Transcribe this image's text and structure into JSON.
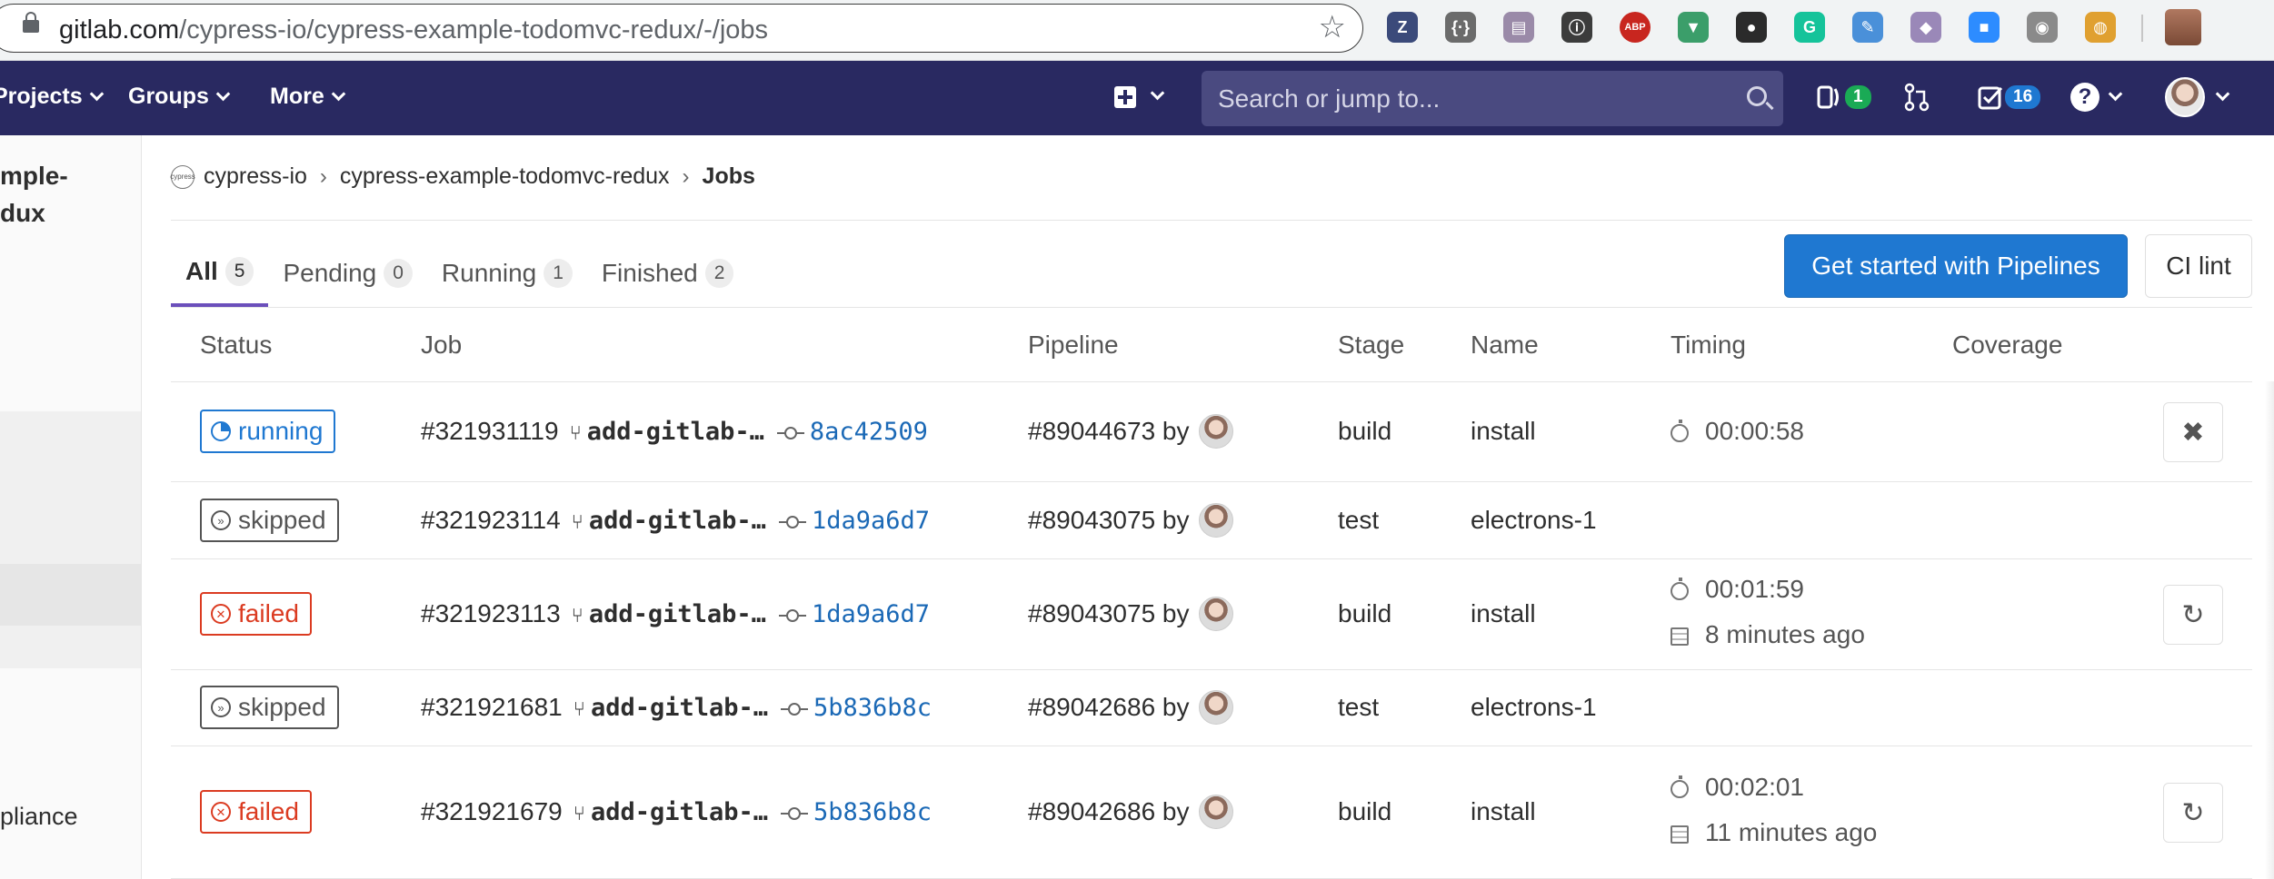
{
  "browser": {
    "url_host": "gitlab.com",
    "url_path": "/cypress-io/cypress-example-todomvc-redux/-/jobs",
    "extensions": [
      {
        "icon": "zotero-icon",
        "glyph": "Z",
        "color": "#3b4a7a"
      },
      {
        "icon": "code-braces-icon",
        "glyph": "{·}",
        "color": "#6b6b6b"
      },
      {
        "icon": "document-extension-icon",
        "glyph": "▤",
        "color": "#9a8aa8"
      },
      {
        "icon": "1password-icon",
        "glyph": "ⓘ",
        "color": "#3c3c3c"
      },
      {
        "icon": "adblock-plus-icon",
        "glyph": "ABP",
        "color": "#c8261f"
      },
      {
        "icon": "vue-devtools-icon",
        "glyph": "▼",
        "color": "#3b9e6a"
      },
      {
        "icon": "bug-mascot-icon",
        "glyph": "●",
        "color": "#2b2b2b"
      },
      {
        "icon": "grammarly-icon",
        "glyph": "G",
        "color": "#15c39a"
      },
      {
        "icon": "feather-icon",
        "glyph": "✎",
        "color": "#4a90d9"
      },
      {
        "icon": "octocat-icon",
        "glyph": "◆",
        "color": "#9a88b8"
      },
      {
        "icon": "zoom-camera-icon",
        "glyph": "■",
        "color": "#2d8cff"
      },
      {
        "icon": "screenshot-camera-icon",
        "glyph": "◉",
        "color": "#8a8a8a"
      },
      {
        "icon": "globe-icon",
        "glyph": "◍",
        "color": "#e0a030"
      }
    ]
  },
  "header": {
    "nav": [
      "Projects",
      "Groups",
      "More"
    ],
    "search_placeholder": "Search or jump to...",
    "issues_count": "1",
    "todos_count": "16",
    "help_glyph": "?"
  },
  "sidebar": {
    "title_line1": "mple-",
    "title_line2": "dux",
    "bottom_item": "pliance"
  },
  "breadcrumb": {
    "group_logo_text": "cypress",
    "group": "cypress-io",
    "project": "cypress-example-todomvc-redux",
    "current": "Jobs",
    "separator": "›"
  },
  "tabs": [
    {
      "label": "All",
      "count": "5"
    },
    {
      "label": "Pending",
      "count": "0"
    },
    {
      "label": "Running",
      "count": "1"
    },
    {
      "label": "Finished",
      "count": "2"
    }
  ],
  "actions": {
    "pipelines_button": "Get started with Pipelines",
    "ci_lint_button": "CI lint"
  },
  "table": {
    "columns": [
      "Status",
      "Job",
      "Pipeline",
      "Stage",
      "Name",
      "Timing",
      "Coverage"
    ],
    "rows": [
      {
        "status": "running",
        "job": "#321931119",
        "branch": "add-gitlab-…",
        "sha": "8ac42509",
        "pipeline": "#89044673 by",
        "stage": "build",
        "name": "install",
        "duration": "00:00:58",
        "finished": "",
        "action": "cancel-icon",
        "action_glyph": "✖"
      },
      {
        "status": "skipped",
        "job": "#321923114",
        "branch": "add-gitlab-…",
        "sha": "1da9a6d7",
        "pipeline": "#89043075 by",
        "stage": "test",
        "name": "electrons-1",
        "duration": "",
        "finished": "",
        "action": "",
        "action_glyph": ""
      },
      {
        "status": "failed",
        "job": "#321923113",
        "branch": "add-gitlab-…",
        "sha": "1da9a6d7",
        "pipeline": "#89043075 by",
        "stage": "build",
        "name": "install",
        "duration": "00:01:59",
        "finished": "8 minutes ago",
        "action": "retry-icon",
        "action_glyph": "↻"
      },
      {
        "status": "skipped",
        "job": "#321921681",
        "branch": "add-gitlab-…",
        "sha": "5b836b8c",
        "pipeline": "#89042686 by",
        "stage": "test",
        "name": "electrons-1",
        "duration": "",
        "finished": "",
        "action": "",
        "action_glyph": ""
      },
      {
        "status": "failed",
        "job": "#321921679",
        "branch": "add-gitlab-…",
        "sha": "5b836b8c",
        "pipeline": "#89042686 by",
        "stage": "build",
        "name": "install",
        "duration": "00:02:01",
        "finished": "11 minutes ago",
        "action": "retry-icon",
        "action_glyph": "↻"
      }
    ]
  },
  "icons": {
    "branch_glyph": "⑂",
    "skipped_glyph": "»",
    "failed_glyph": "✕",
    "star_glyph": "☆"
  }
}
